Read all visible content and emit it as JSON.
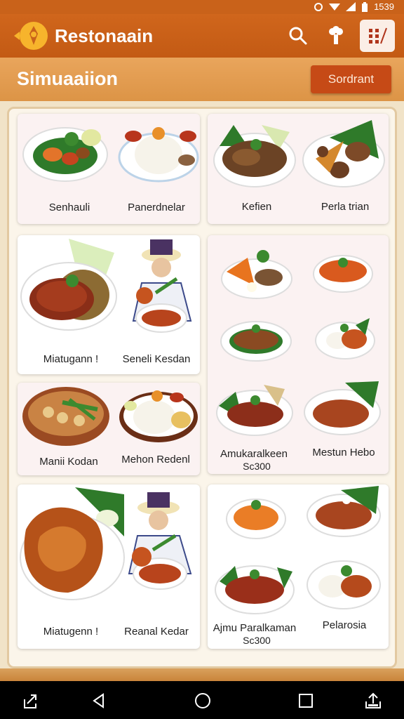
{
  "status": {
    "time": "1539"
  },
  "app": {
    "title": "Restonaain"
  },
  "header": {
    "title": "Simuaaiion",
    "sort_label": "Sordrant"
  },
  "dishes": [
    {
      "label": "Senhauli"
    },
    {
      "label": "Panerdnelar"
    },
    {
      "label": "Kefien"
    },
    {
      "label": "Perla trian"
    },
    {
      "label": "Miatugann !"
    },
    {
      "label": "Seneli Kesdan"
    },
    {
      "label": "Manii Kodan"
    },
    {
      "label": "Mehon Redenl"
    },
    {
      "label": "Amukaralkeen",
      "price": "Sc300"
    },
    {
      "label": "Mestun Hebo"
    },
    {
      "label": "Miatugenn !"
    },
    {
      "label": "Reanal Kedar"
    },
    {
      "label": "Ajmu Paralkaman",
      "price": "Sc300"
    },
    {
      "label": "Pelarosia"
    }
  ],
  "icons": {
    "logo": "restaurant-logo-icon",
    "search": "search-icon",
    "chef": "chef-icon",
    "menu": "menu-grid-icon",
    "nav": [
      "share-icon",
      "back-icon",
      "home-icon",
      "recents-icon",
      "upload-icon"
    ]
  },
  "colors": {
    "app_bar": "#c9621a",
    "sub_header": "#e3a052",
    "button": "#c64a16",
    "panel": "#fbf5ea"
  }
}
